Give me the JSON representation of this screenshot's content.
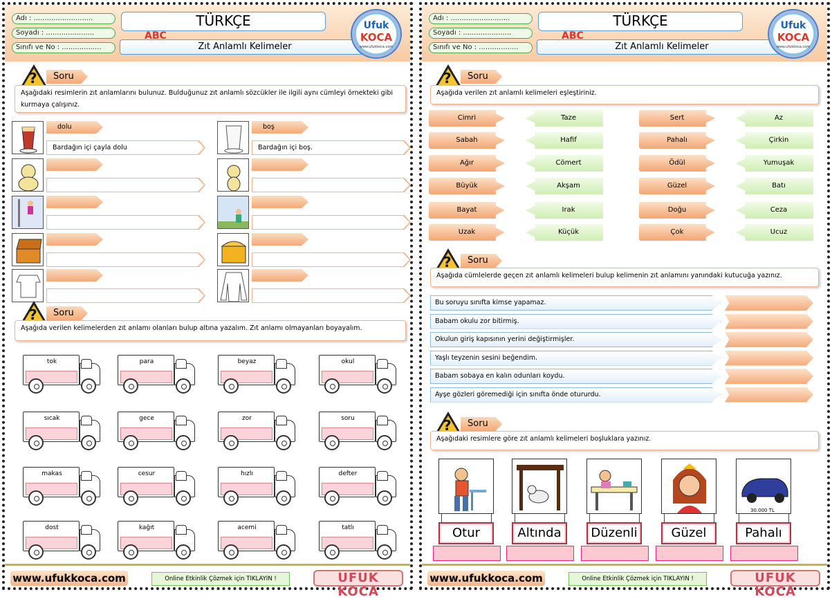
{
  "header": {
    "name_label": "Adı : ",
    "name_dots": "...........................",
    "surname_label": "Soyadı : ",
    "surname_dots": "......................",
    "class_label": "Sınıfı ve No : ",
    "class_dots": "..................",
    "subject": "TÜRKÇE",
    "topic": "Zıt Anlamlı Kelimeler",
    "abc": "ABC",
    "logo_line1": "Ufuk",
    "logo_line2": "KOCA",
    "logo_url": "www.ufukkoca.com"
  },
  "soru_label": "Soru",
  "left": {
    "q1": "Aşağıdaki resimlerin zıt anlamlarını bulunuz. Bulduğunuz zıt anlamlı sözcükler ile ilgili aynı cümleyi örnekteki gibi kurmaya çalışınız.",
    "example": {
      "left_word": "dolu",
      "left_sentence": "Bardağın içi çayla dolu",
      "right_word": "boş",
      "right_sentence": "Bardağın içi boş."
    },
    "q2": "Aşağıda verilen kelimelerden zıt anlamı olanları bulup altına yazalım. Zıt anlamı olmayanları boyayalım.",
    "trucks": [
      "tok",
      "para",
      "beyaz",
      "okul",
      "sıcak",
      "gece",
      "zor",
      "soru",
      "makas",
      "cesur",
      "hızlı",
      "defter",
      "dost",
      "kağıt",
      "acemi",
      "tatlı"
    ]
  },
  "right": {
    "q1": "Aşağıda verilen zıt anlamlı kelimeleri eşleştiriniz.",
    "match_left_a": [
      "Cimri",
      "Sabah",
      "Ağır",
      "Büyük",
      "Bayat",
      "Uzak"
    ],
    "match_left_b": [
      "Taze",
      "Hafif",
      "Cömert",
      "Akşam",
      "Irak",
      "Küçük"
    ],
    "match_right_a": [
      "Sert",
      "Pahalı",
      "Ödül",
      "Güzel",
      "Doğu",
      "Çok"
    ],
    "match_right_b": [
      "Az",
      "Çirkin",
      "Yumuşak",
      "Batı",
      "Ceza",
      "Ucuz"
    ],
    "q2": "Aşağıda cümlelerde geçen zıt anlamlı kelimeleri bulup kelimenin zıt anlamını yanındaki kutucuğa yazınız.",
    "sentences": [
      "Bu soruyu sınıfta kimse yapamaz.",
      "Babam okulu zor bitirmiş.",
      "Okulun giriş kapısının yerini değiştirmişler.",
      "Yaşlı teyzenin sesini beğendim.",
      "Babam sobaya en kalın odunları koydu.",
      "Ayşe gözleri göremediği için sınıfta önde otururdu."
    ],
    "q3": "Aşağıdaki resimlere göre zıt anlamlı kelimeleri boşluklara yazınız.",
    "picture_words": [
      "Otur",
      "Altında",
      "Düzenli",
      "Güzel",
      "Pahalı"
    ],
    "car_price": "30.000 TL"
  },
  "footer": {
    "site": "www.ufukkoca.com",
    "online": "Online Etkinlik Çözmek için TIKLAYIN !",
    "brand": "UFUK KOCA"
  }
}
